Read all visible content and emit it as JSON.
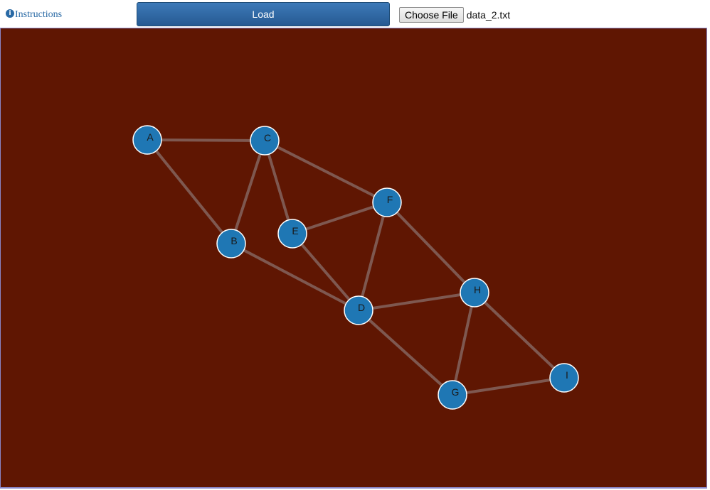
{
  "toolbar": {
    "instructions_label": "Instructions",
    "load_label": "Load",
    "choose_file_label": "Choose File",
    "file_name": "data_2.txt"
  },
  "graph": {
    "colors": {
      "background": "#5f1602",
      "edge": "#7e5850",
      "node_fill": "#1f77b4",
      "node_stroke": "#ffffff",
      "label": "#1a1a1a"
    },
    "nodes": [
      {
        "id": "A",
        "label": "A"
      },
      {
        "id": "B",
        "label": "B"
      },
      {
        "id": "C",
        "label": "C"
      },
      {
        "id": "D",
        "label": "D"
      },
      {
        "id": "E",
        "label": "E"
      },
      {
        "id": "F",
        "label": "F"
      },
      {
        "id": "G",
        "label": "G"
      },
      {
        "id": "H",
        "label": "H"
      },
      {
        "id": "I",
        "label": "I"
      }
    ],
    "edges": [
      [
        "A",
        "C"
      ],
      [
        "A",
        "B"
      ],
      [
        "C",
        "B"
      ],
      [
        "C",
        "E"
      ],
      [
        "C",
        "F"
      ],
      [
        "E",
        "F"
      ],
      [
        "E",
        "D"
      ],
      [
        "B",
        "D"
      ],
      [
        "F",
        "D"
      ],
      [
        "F",
        "H"
      ],
      [
        "D",
        "H"
      ],
      [
        "D",
        "G"
      ],
      [
        "H",
        "G"
      ],
      [
        "H",
        "I"
      ],
      [
        "G",
        "I"
      ]
    ]
  }
}
